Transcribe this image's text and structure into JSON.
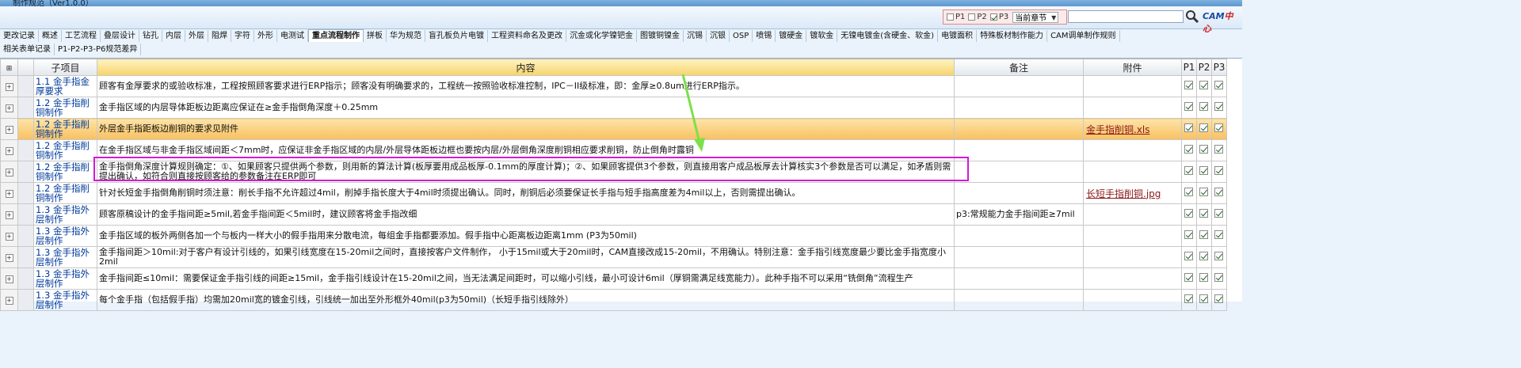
{
  "window": {
    "title": "制作规范（Ver1.0.0）"
  },
  "filter": {
    "p1_label": "P1",
    "p1_checked": false,
    "p2_label": "P2",
    "p2_checked": false,
    "p3_label": "P3",
    "p3_checked": true,
    "scope_selected": "当前章节"
  },
  "search": {
    "value": "",
    "placeholder": ""
  },
  "logo": {
    "text_a": "CAM",
    "text_b": "中心"
  },
  "tabs_row1": [
    "更改记录",
    "概述",
    "工艺流程",
    "叠层设计",
    "钻孔",
    "内层",
    "外层",
    "阻焊",
    "字符",
    "外形",
    "电测试",
    "重点流程制作",
    "拼板",
    "华为规范",
    "盲孔板负片电镀",
    "工程资料命名及更改",
    "沉金或化学镍钯金",
    "图镀铜镍金",
    "沉锡",
    "沉银",
    "OSP",
    "喷锡",
    "镀硬金",
    "镀软金",
    "无镍电镀金(含硬金、软金)",
    "电镀面积",
    "特殊板材制作能力",
    "CAM调单制作规则"
  ],
  "active_tab": "重点流程制作",
  "tabs_row2": [
    "相关表单记录",
    "P1-P2-P3-P6规范差异"
  ],
  "columns": {
    "item": "子项目",
    "content": "内容",
    "note": "备注",
    "attach": "附件",
    "p1": "P1",
    "p2": "P2",
    "p3": "P3"
  },
  "rows": [
    {
      "item": "1.1 金手指金厚要求",
      "content": "顾客有金厚要求的或验收标准，工程按照顾客要求进行ERP指示；顾客没有明确要求的，工程统一按照验收标准控制，IPC－II级标准，即：金厚≥0.8um进行ERP指示。",
      "note": "",
      "attach": "",
      "p1": true,
      "p2": true,
      "p3": true,
      "highlight": false
    },
    {
      "item": "1.2 金手指削铜制作",
      "content": "金手指区域的内层导体距板边距离应保证在≥金手指倒角深度＋0.25mm",
      "note": "",
      "attach": "",
      "p1": true,
      "p2": true,
      "p3": true,
      "highlight": false
    },
    {
      "item": "1.2 金手指削铜制作",
      "content": "外层金手指距板边削铜的要求见附件",
      "note": "",
      "attach": "金手指削铜.xls",
      "p1": true,
      "p2": true,
      "p3": true,
      "highlight": true
    },
    {
      "item": "1.2 金手指削铜制作",
      "content": "在金手指区域与非金手指区域间距＜7mm时，应保证非金手指区域的内层/外层导体距板边框也要按内层/外层倒角深度削铜相应要求削铜，防止倒角时露铜",
      "note": "",
      "attach": "",
      "p1": true,
      "p2": true,
      "p3": true,
      "highlight": false
    },
    {
      "item": "1.2 金手指削铜制作",
      "content": "金手指倒角深度计算规则确定：①、如果顾客只提供两个参数，则用新的算法计算(板厚要用成品板厚-0.1mm的厚度计算)；②、如果顾客提供3个参数，则直接用客户成品板厚去计算核实3个参数是否可以满足，如矛盾则需提出确认，如符合则直接按顾客给的参数备注在ERP即可",
      "note": "",
      "attach": "",
      "p1": true,
      "p2": true,
      "p3": true,
      "highlight": false
    },
    {
      "item": "1.2 金手指削铜制作",
      "content": "针对长短金手指倒角削铜时须注意：削长手指不允许超过4mil，削掉手指长度大于4mil时须提出确认。同时，削铜后必须要保证长手指与短手指高度差为4mil以上，否则需提出确认。",
      "note": "",
      "attach": "长短手指削铜.jpg",
      "p1": true,
      "p2": true,
      "p3": true,
      "highlight": false
    },
    {
      "item": "1.3 金手指外层制作",
      "content": "顾客原稿设计的金手指间距≥5mil,若金手指间距＜5mil时，建议顾客将金手指改细",
      "note": "p3:常规能力金手指间距≥7mil",
      "attach": "",
      "p1": true,
      "p2": true,
      "p3": true,
      "highlight": false
    },
    {
      "item": "1.3 金手指外层制作",
      "content": "金手指区域的板外两侧各加一个与板内一样大小的假手指用来分散电流，每组金手指都要添加。假手指中心距离板边距离1mm (P3为50mil)",
      "note": "",
      "attach": "",
      "p1": true,
      "p2": true,
      "p3": true,
      "highlight": false
    },
    {
      "item": "1.3 金手指外层制作",
      "content": "金手指间距＞10mil:对于客户有设计引线的，如果引线宽度在15-20mil之间时，直接按客户文件制作， 小于15mil或大于20mil时，CAM直接改成15-20mil，不用确认。特别注意：金手指引线宽度最少要比金手指宽度小2mil",
      "note": "",
      "attach": "",
      "p1": true,
      "p2": true,
      "p3": true,
      "highlight": false
    },
    {
      "item": "1.3 金手指外层制作",
      "content": "金手指间距≤10mil：需要保证金手指引线的间距≥15mil，金手指引线设计在15-20mil之间，当无法满足间距时，可以缩小引线，最小可设计6mil（厚铜需满足线宽能力）。此种手指不可以采用“铣倒角”流程生产",
      "note": "",
      "attach": "",
      "p1": true,
      "p2": true,
      "p3": true,
      "highlight": false
    },
    {
      "item": "1.3 金手指外层制作",
      "content": "每个金手指（包括假手指）均需加20mil宽的镀金引线，引线统一加出至外形框外40mil(p3为50mil)（长短手指引线除外）",
      "note": "",
      "attach": "",
      "p1": true,
      "p2": true,
      "p3": true,
      "highlight": false
    }
  ]
}
